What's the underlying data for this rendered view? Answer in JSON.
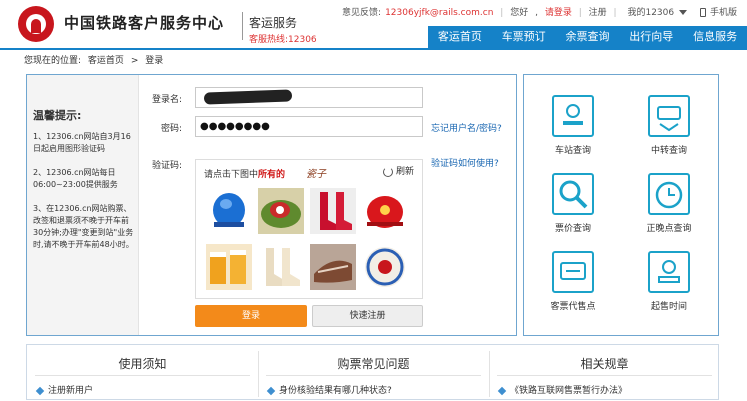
{
  "header": {
    "site_name": "中国铁路客户服务中心",
    "sub_title": "客运服务",
    "hotline": "客服热线:12306",
    "feedback_label": "意见反馈:",
    "feedback_email": "12306yjfk@rails.com.cn",
    "greeting": "您好",
    "login_link": "请登录",
    "register_link": "注册",
    "my_account": "我的12306",
    "mobile": "手机版"
  },
  "nav": {
    "items": [
      {
        "label": "客运首页"
      },
      {
        "label": "车票预订"
      },
      {
        "label": "余票查询"
      },
      {
        "label": "出行向导"
      },
      {
        "label": "信息服务"
      }
    ]
  },
  "breadcrumb": {
    "prefix": "您现在的位置:",
    "home": "客运首页",
    "separator": ">",
    "current": "登录"
  },
  "tips": {
    "title": "温馨提示:",
    "items": [
      "1、12306.cn网站自3月16日起启用图形验证码",
      "2、12306.cn网站每日06:00~23:00提供服务",
      "3、在12306.cn网站购票、改签和退票须不晚于开车前30分钟;办理\"变更到站\"业务时,请不晚于开车前48小时。"
    ]
  },
  "form": {
    "username_label": "登录名:",
    "password_label": "密码:",
    "password_value": "●●●●●●●●",
    "captcha_label": "验证码:",
    "forgot_link": "忘记用户名/密码?",
    "captcha_help": "验证码如何使用?",
    "captcha_prompt_prefix": "请点击下图中",
    "captcha_prompt_highlight": "所有的",
    "captcha_char": "瓷子",
    "refresh_label": "刷新",
    "login_button": "登录",
    "register_button": "快速注册"
  },
  "services": {
    "items": [
      {
        "label": "车站查询",
        "icon": "station-icon"
      },
      {
        "label": "中转查询",
        "icon": "transfer-icon"
      },
      {
        "label": "票价查询",
        "icon": "fare-search-icon"
      },
      {
        "label": "正晚点查询",
        "icon": "clock-icon"
      },
      {
        "label": "客票代售点",
        "icon": "ticket-agency-icon"
      },
      {
        "label": "起售时间",
        "icon": "sale-time-icon"
      }
    ]
  },
  "bottom": {
    "columns": [
      {
        "title": "使用须知",
        "item": "注册新用户"
      },
      {
        "title": "购票常见问题",
        "item": "身份核验结果有哪几种状态?"
      },
      {
        "title": "相关规章",
        "item": "《铁路互联网售票暂行办法》"
      }
    ]
  },
  "colors": {
    "nav_blue": "#1582c8",
    "brand_red": "#c8161d",
    "login_orange": "#f38a1a",
    "link_blue": "#1a67b2"
  }
}
